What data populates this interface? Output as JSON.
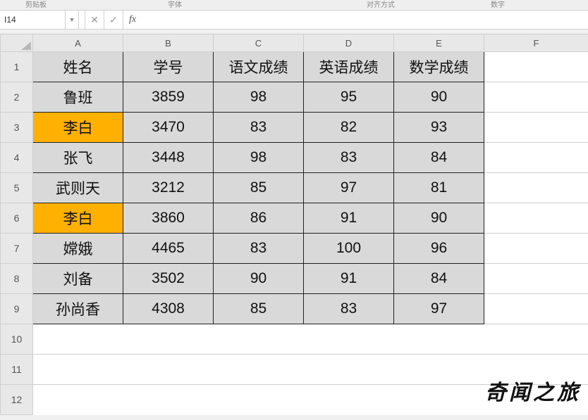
{
  "ribbon_fragments": {
    "a": "剪贴板",
    "b": "字体",
    "c": "对齐方式",
    "d": "数字"
  },
  "namebox": {
    "value": "I14"
  },
  "formula": {
    "value": "",
    "fx": "fx",
    "cancel": "✕",
    "confirm": "✓"
  },
  "columns": [
    "A",
    "B",
    "C",
    "D",
    "E",
    "F"
  ],
  "row_numbers": [
    1,
    2,
    3,
    4,
    5,
    6,
    7,
    8,
    9,
    10,
    11,
    12
  ],
  "headers": [
    "姓名",
    "学号",
    "语文成绩",
    "英语成绩",
    "数学成绩"
  ],
  "rows": [
    {
      "name": "鲁班",
      "id": "3859",
      "yu": "98",
      "en": "95",
      "ma": "90",
      "hl": false
    },
    {
      "name": "李白",
      "id": "3470",
      "yu": "83",
      "en": "82",
      "ma": "93",
      "hl": true
    },
    {
      "name": "张飞",
      "id": "3448",
      "yu": "98",
      "en": "83",
      "ma": "84",
      "hl": false
    },
    {
      "name": "武则天",
      "id": "3212",
      "yu": "85",
      "en": "97",
      "ma": "81",
      "hl": false
    },
    {
      "name": "李白",
      "id": "3860",
      "yu": "86",
      "en": "91",
      "ma": "90",
      "hl": true
    },
    {
      "name": "嫦娥",
      "id": "4465",
      "yu": "83",
      "en": "100",
      "ma": "96",
      "hl": false
    },
    {
      "name": "刘备",
      "id": "3502",
      "yu": "90",
      "en": "91",
      "ma": "84",
      "hl": false
    },
    {
      "name": "孙尚香",
      "id": "4308",
      "yu": "85",
      "en": "83",
      "ma": "97",
      "hl": false
    }
  ],
  "watermark": "奇闻之旅"
}
